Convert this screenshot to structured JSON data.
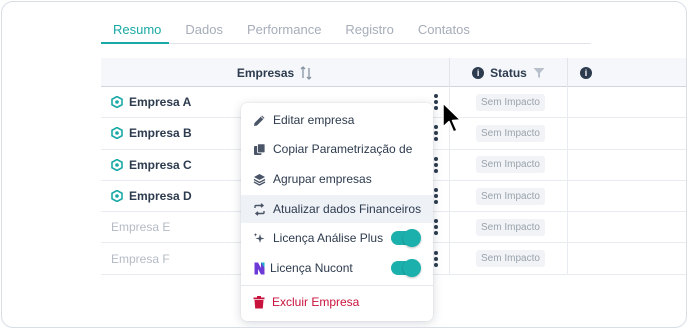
{
  "tabs": [
    {
      "label": "Resumo",
      "active": true
    },
    {
      "label": "Dados",
      "active": false
    },
    {
      "label": "Performance",
      "active": false
    },
    {
      "label": "Registro",
      "active": false
    },
    {
      "label": "Contatos",
      "active": false
    }
  ],
  "table": {
    "columns": {
      "empresas": "Empresas",
      "status": "Status"
    },
    "rows": [
      {
        "name": "Empresa A",
        "status": "Sem Impacto",
        "enabled": true
      },
      {
        "name": "Empresa B",
        "status": "Sem Impacto",
        "enabled": true
      },
      {
        "name": "Empresa C",
        "status": "Sem Impacto",
        "enabled": true
      },
      {
        "name": "Empresa D",
        "status": "Sem Impacto",
        "enabled": true
      },
      {
        "name": "Empresa E",
        "status": "Sem Impacto",
        "enabled": false
      },
      {
        "name": "Empresa F",
        "status": "Sem Impacto",
        "enabled": false
      }
    ]
  },
  "menu": {
    "items": [
      {
        "label": "Editar empresa",
        "icon": "pencil-icon"
      },
      {
        "label": "Copiar Parametrização de",
        "icon": "copy-icon"
      },
      {
        "label": "Agrupar empresas",
        "icon": "layers-icon"
      },
      {
        "label": "Atualizar dados Financeiros",
        "icon": "refresh-icon",
        "highlighted": true
      },
      {
        "label": "Licença Análise Plus",
        "icon": "sparkle-icon",
        "toggle": true
      },
      {
        "label": "Licença Nucont",
        "icon": "nucont-logo-icon",
        "toggle": true
      },
      {
        "label": "Excluir Empresa",
        "icon": "trash-icon",
        "danger": true
      }
    ]
  },
  "colors": {
    "accent": "#1aa9a6",
    "text": "#2d3b4e",
    "danger": "#c8143c"
  }
}
